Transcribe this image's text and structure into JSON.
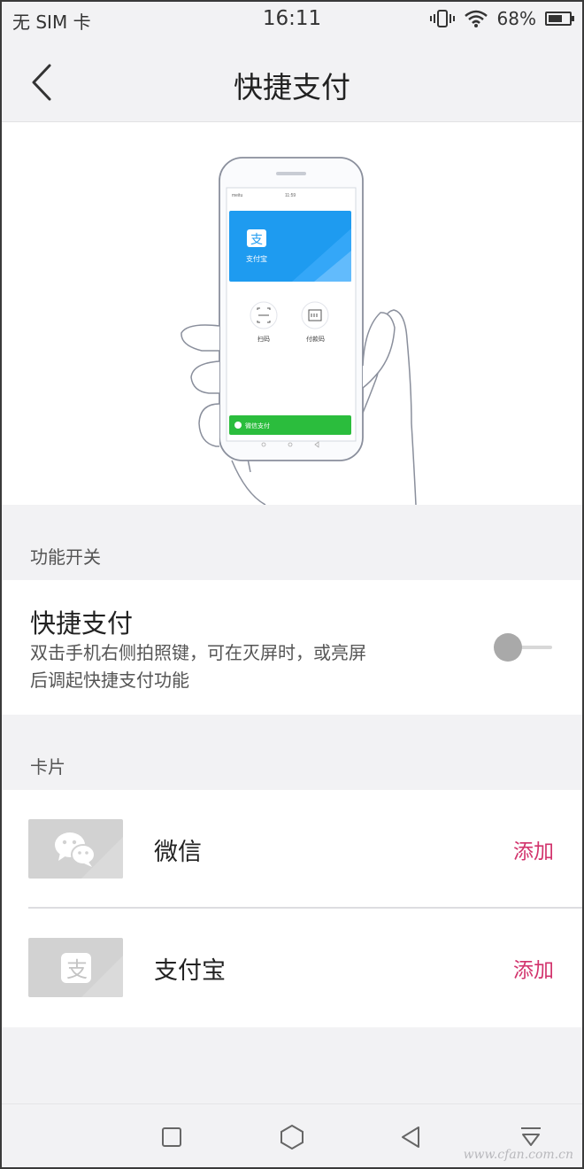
{
  "status_bar": {
    "carrier": "无 SIM 卡",
    "time": "16:11",
    "battery": "68%",
    "battery_level": 0.68,
    "icons": [
      "vibrate-icon",
      "wifi-icon",
      "battery-icon"
    ]
  },
  "nav": {
    "back_icon": "chevron-left-icon",
    "title": "快捷支付"
  },
  "illustration": {
    "phone_status_left": "meitu",
    "phone_status_time": "11:59",
    "alipay_card_label": "支付宝",
    "scan_label": "扫码",
    "paycode_label": "付款码",
    "wechat_card_label": "微信支付",
    "colors": {
      "alipay": "#1e9bf0",
      "wechat": "#2bbd3d"
    }
  },
  "sections": {
    "function_switch": "功能开关",
    "cards": "卡片"
  },
  "quick_pay": {
    "title": "快捷支付",
    "description_line1": "双击手机右侧拍照键，可在灭屏时，或亮屏",
    "description_line2": "后调起快捷支付功能",
    "enabled": false
  },
  "cards": [
    {
      "name": "微信",
      "action": "添加",
      "icon": "wechat-icon"
    },
    {
      "name": "支付宝",
      "action": "添加",
      "icon": "alipay-icon"
    }
  ],
  "bottom_nav": {
    "icons": [
      "square-recents-icon",
      "hexagon-home-icon",
      "triangle-back-icon",
      "pull-down-icon"
    ]
  },
  "watermark": "www.cfan.com.cn",
  "colors": {
    "accent": "#d2336c",
    "background": "#f2f2f4",
    "card_thumb": "#d2d2d2"
  }
}
